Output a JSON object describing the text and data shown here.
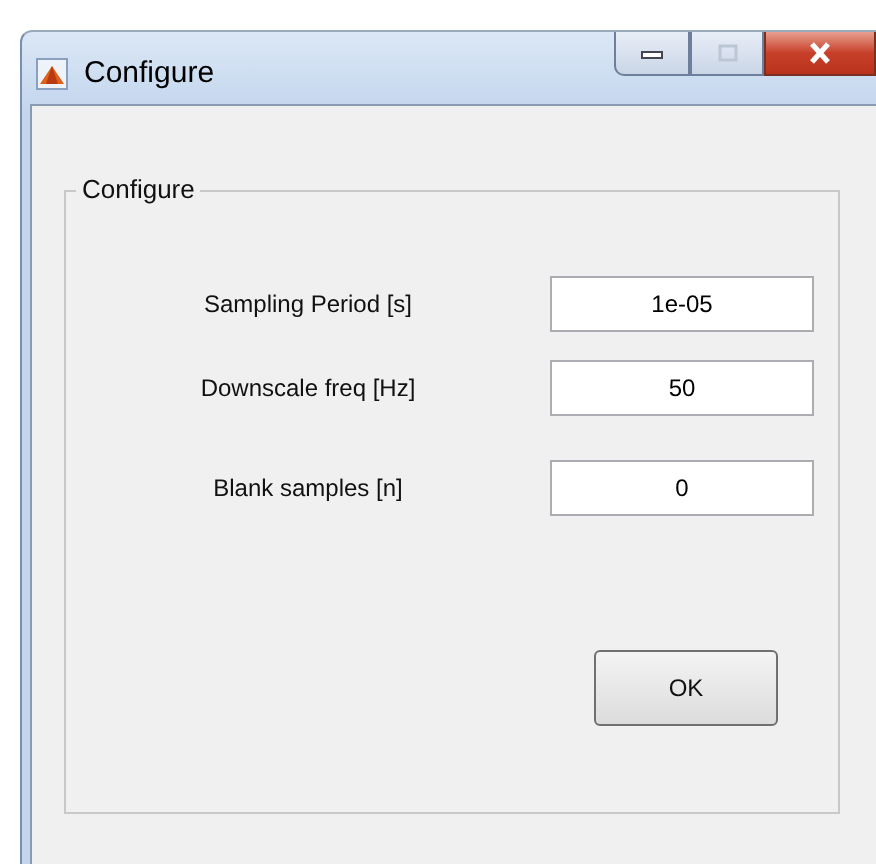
{
  "window": {
    "title": "Configure"
  },
  "panel": {
    "title": "Configure"
  },
  "fields": [
    {
      "label": "Sampling Period [s]",
      "value": "1e-05"
    },
    {
      "label": "Downscale freq [Hz]",
      "value": "50"
    },
    {
      "label": "Blank samples [n]",
      "value": "0"
    }
  ],
  "buttons": [
    "OK"
  ]
}
